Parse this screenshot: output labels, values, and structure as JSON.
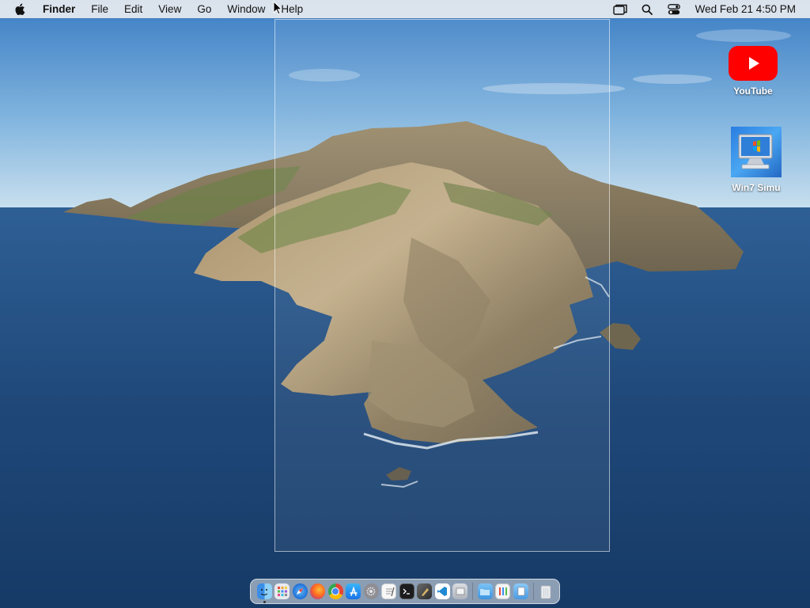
{
  "menubar": {
    "app_name": "Finder",
    "menus": [
      "File",
      "Edit",
      "View",
      "Go",
      "Window",
      "Help"
    ],
    "status_icons": [
      "screen-mirroring-icon",
      "spotlight-search-icon",
      "control-center-icon"
    ],
    "clock": "Wed Feb 21  4:50 PM"
  },
  "desktop_icons": [
    {
      "label": "YouTube",
      "icon": "youtube-icon"
    },
    {
      "label": "Win7 Simu",
      "icon": "win7-simulator-icon"
    }
  ],
  "dock": {
    "apps": [
      {
        "name": "finder-icon",
        "running": true
      },
      {
        "name": "launchpad-icon",
        "running": false
      },
      {
        "name": "safari-icon",
        "running": false
      },
      {
        "name": "firefox-icon",
        "running": false
      },
      {
        "name": "chrome-icon",
        "running": false
      },
      {
        "name": "app-store-icon",
        "running": false
      },
      {
        "name": "system-preferences-icon",
        "running": false
      },
      {
        "name": "textedit-icon",
        "running": false
      },
      {
        "name": "terminal-icon",
        "running": false
      },
      {
        "name": "script-editor-icon",
        "running": false
      },
      {
        "name": "vscode-icon",
        "running": false
      },
      {
        "name": "preview-icon",
        "running": false
      },
      {
        "name": "downloads-folder-icon",
        "running": false
      },
      {
        "name": "applications-stack-icon",
        "running": false
      },
      {
        "name": "documents-stack-icon",
        "running": false
      },
      {
        "name": "trash-icon",
        "running": false
      }
    ]
  },
  "colors": {
    "youtube_red": "#ff0000",
    "menubar_bg": "#e8ecf0"
  }
}
